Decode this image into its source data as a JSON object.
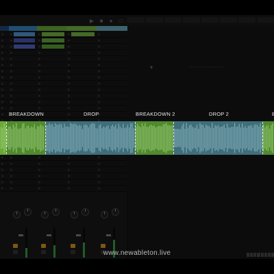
{
  "topbar": {
    "transport": [
      "▶",
      "■",
      "●",
      "□"
    ]
  },
  "tracks": [
    {
      "color": "#3a8fd0",
      "clips": [
        "",
        "",
        "",
        "",
        "",
        "",
        "",
        "",
        "",
        "",
        "",
        "",
        "",
        "",
        "",
        "",
        "",
        "",
        "",
        "",
        "",
        "",
        "",
        "",
        "",
        "",
        "",
        ""
      ],
      "clip_colors": [
        "#5aa0e0",
        "#4a5cb8",
        "#5a6ad0"
      ]
    },
    {
      "color": "#6fb23c",
      "clips": [],
      "clip_colors": [
        "#7cc04a",
        "#6bb23e",
        "#5ea83a"
      ]
    },
    {
      "color": "#7cc04a",
      "clips": [],
      "clip_colors": [
        "#7cc04a"
      ]
    },
    {
      "color": "#6fb3c9",
      "clips": [],
      "clip_colors": []
    }
  ],
  "sections": [
    {
      "label": "BREAKDOWN",
      "color": "#6aa83a"
    },
    {
      "label": "DROP",
      "color": "#5a8c9a"
    },
    {
      "label": "BREAKDOWN 2",
      "color": "#6aa83a"
    },
    {
      "label": "DROP 2",
      "color": "#5a8c9a"
    },
    {
      "label": "B",
      "color": "#6aa83a"
    }
  ],
  "arrangement": {
    "drop_hint": "Drop Files and Devices Here"
  },
  "footer": {
    "url": "www.newableton.live"
  }
}
